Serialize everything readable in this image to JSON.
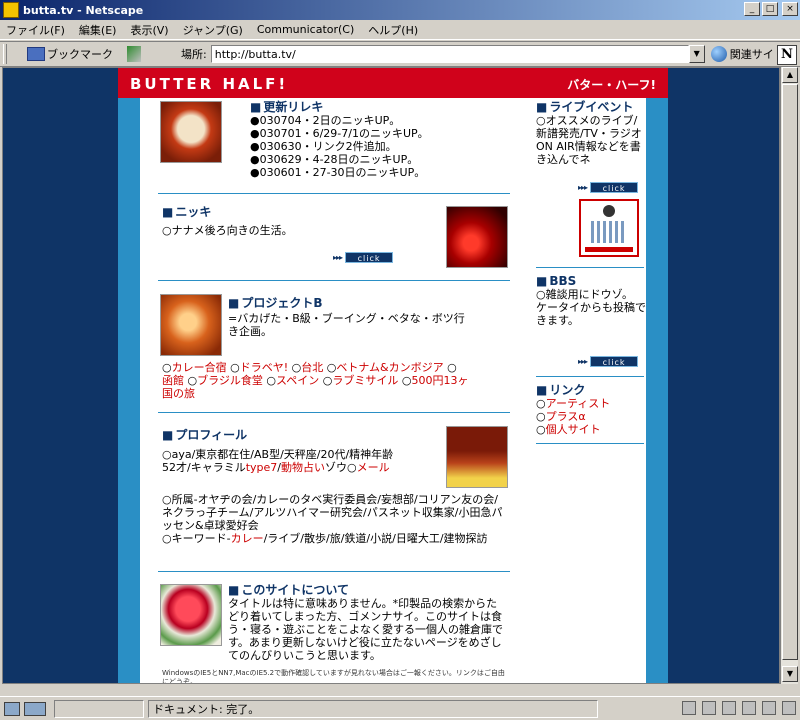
{
  "window": {
    "title": "butta.tv - Netscape",
    "buttons": [
      "_",
      "□",
      "×"
    ]
  },
  "menu": [
    "ファイル(F)",
    "編集(E)",
    "表示(V)",
    "ジャンプ(G)",
    "Communicator(C)",
    "ヘルプ(H)"
  ],
  "toolbar": {
    "bookmark_label": "ブックマーク",
    "location_label": "場所:",
    "url": "http://butta.tv/",
    "related_label": "関連サイト",
    "logo": "N"
  },
  "site": {
    "header_en": "BUTTER HALF!",
    "header_jp": "バター・ハーフ!",
    "update": {
      "title": "更新リレキ",
      "items": [
        "●030704・2日のニッキUP。",
        "●030701・6/29-7/1のニッキUP。",
        "●030630・リンク2件追加。",
        "●030629・4-28日のニッキUP。",
        "●030601・27-30日のニッキUP。"
      ]
    },
    "nikki": {
      "title": "ニッキ",
      "text": "○ナナメ後ろ向きの生活。"
    },
    "project": {
      "title": "プロジェクトB",
      "text": "=バカげた・B級・ブーイング・ベタな・ボツ行き企画。",
      "links_line1": [
        "○",
        "カレー合宿",
        " ○",
        "ドラベヤ!",
        " ○",
        "台北",
        " ○",
        "ベトナム&カンボジア",
        " ○"
      ],
      "links_line2": [
        "函館",
        " ○",
        "ブラジル食堂",
        " ○",
        "スペイン",
        " ○",
        "ラブミサイル",
        " ○",
        "500円13ヶ"
      ],
      "links_line3": "国の旅"
    },
    "profile": {
      "title": "プロフィール",
      "line1": "○aya/東京都在住/AB型/天秤座/20代/精神年齢",
      "line2a": "52才/キャラミル",
      "line2b": "type7",
      "line2c": "/",
      "line2d": "動物占い",
      "line2e": "ゾウ○",
      "line2f": "メール",
      "line3": "○所属-オヤヂの会/カレーのタベ実行委員会/妄想部/コリアン友の会/ネクラっ子チーム/アルツハイマー研究会/パスネット収集家/小田急パッセン&卓球愛好会",
      "line4a": "○キーワード-",
      "line4b": "カレー",
      "line4c": "/ライブ/散歩/旅/鉄道/小説/日曜大工/建物探訪"
    },
    "about": {
      "title": "このサイトについて",
      "text": "タイトルは特に意味ありません。*印製品の検索からたどり着いてしまった方、ゴメンナサイ。このサイトは食う・寝る・遊ぶことをこよなく愛する一個人の雑倉庫です。あまり更新しないけど役に立たないページをめざしてのんびりいこうと思います。",
      "note": "WindowsのIE5とNN7,MacのIE5.2で動作確認していますが見れない場合はご一報ください。リンクはご自由にどうぞ。"
    },
    "live": {
      "title": "ライブイベント",
      "text": "○オススメのライブ/新譜発売/TV・ラジオON AIR情報などを書き込んでネ"
    },
    "bbs": {
      "title": "BBS",
      "text1": "○雑談用にドウゾ。",
      "text2": "ケータイからも投稿できます。"
    },
    "links": {
      "title": "リンク",
      "items": [
        "アーティスト",
        "プラスα",
        "個人サイト"
      ]
    },
    "click_label": "click",
    "arrows": "▸▸▸"
  },
  "status": {
    "text": "ドキュメント: 完了。"
  },
  "colors": {
    "navy": "#0f3466",
    "red": "#d0021b",
    "accent_blue": "#2a8fc5"
  }
}
